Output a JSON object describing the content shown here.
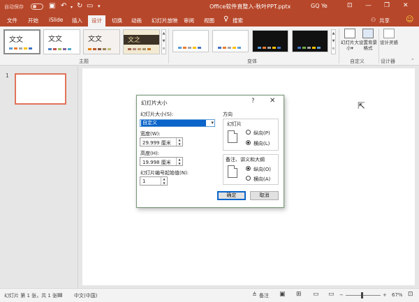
{
  "titlebar": {
    "autosave": "自动保存",
    "doc_title": "Office软件直整入-秋叶PPT.pptx",
    "user": "GQ Ye"
  },
  "tabs": [
    "文件",
    "开始",
    "iSlide",
    "插入",
    "设计",
    "切换",
    "动画",
    "幻灯片放映",
    "审阅",
    "视图"
  ],
  "active_tab": "设计",
  "search_label": "搜索",
  "share_label": "共享",
  "ribbon": {
    "theme_text": "文文",
    "theme_alt_text": "文之",
    "themes_group": "主题",
    "variants_group": "变体",
    "customize_group": "自定义",
    "designer_group": "设计器",
    "slide_size": "幻灯片大小",
    "slide_size_arrow": "▾",
    "format_background": "设置背景格式",
    "design_ideas": "设计灵感"
  },
  "slides_panel": {
    "slide_number": "1"
  },
  "dialog": {
    "title": "幻灯片大小",
    "help": "?",
    "close": "✕",
    "size_label": "幻灯片大小(S):",
    "size_value": "自定义",
    "width_label": "宽度(W):",
    "width_value": "29.999 厘米",
    "height_label": "高度(H):",
    "height_value": "19.998 厘米",
    "number_from_label": "幻灯片编号起始值(N):",
    "number_from_value": "1",
    "orientation_label": "方向",
    "slides_label": "幻灯片",
    "slides_portrait": "纵向(P)",
    "slides_landscape": "横向(L)",
    "notes_label": "备注、讲义和大纲",
    "notes_portrait": "纵向(O)",
    "notes_landscape": "横向(A)",
    "ok": "确定",
    "cancel": "取消"
  },
  "statusbar": {
    "slide_info": "幻灯片 第 1 张，共 1 张",
    "language": "中文(中国)",
    "notes": "备注",
    "zoom": "67%",
    "zoom_minus": "−",
    "zoom_plus": "+"
  },
  "colors": {
    "accent": "#b7472a",
    "selected_blue": "#0a64c9",
    "thumb_border": "#e0735a"
  }
}
